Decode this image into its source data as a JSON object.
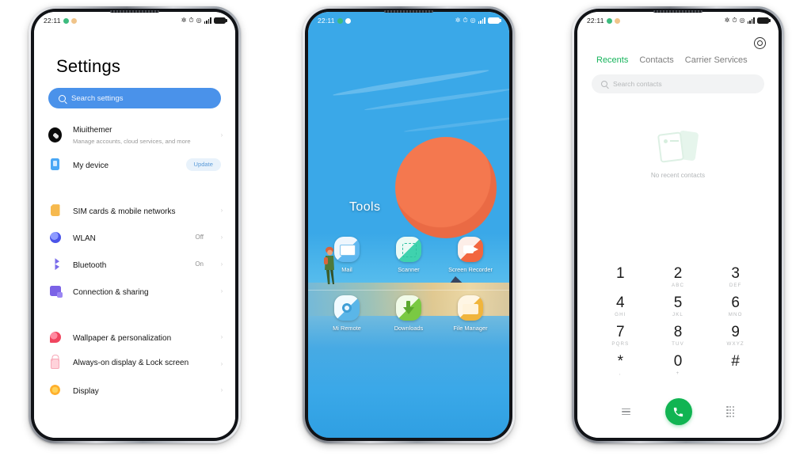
{
  "statusbar": {
    "time": "22:11",
    "icons": [
      "bluetooth-icon",
      "alarm-icon",
      "dnd-icon",
      "signal-icon",
      "battery-icon"
    ]
  },
  "phone1": {
    "app": "Settings",
    "title": "Settings",
    "search": {
      "placeholder": "Search settings",
      "icon": "search-icon"
    },
    "account": {
      "name": "Miuithemer",
      "subtitle": "Manage accounts, cloud services, and more",
      "avatar": "user-avatar"
    },
    "items": [
      {
        "label": "My device",
        "value": "",
        "badge": "Update",
        "icon": "device-icon"
      },
      {
        "label": "SIM cards & mobile networks",
        "value": "",
        "badge": "",
        "icon": "sim-icon"
      },
      {
        "label": "WLAN",
        "value": "Off",
        "badge": "",
        "icon": "wifi-icon"
      },
      {
        "label": "Bluetooth",
        "value": "On",
        "badge": "",
        "icon": "bluetooth-icon"
      },
      {
        "label": "Connection & sharing",
        "value": "",
        "badge": "",
        "icon": "connection-icon"
      },
      {
        "label": "Wallpaper & personalization",
        "value": "",
        "badge": "",
        "icon": "wallpaper-icon"
      },
      {
        "label": "Always-on display & Lock screen",
        "value": "",
        "badge": "",
        "icon": "lock-icon"
      },
      {
        "label": "Display",
        "value": "",
        "badge": "",
        "icon": "display-icon"
      }
    ]
  },
  "phone2": {
    "app": "Home screen folder",
    "folder_title": "Tools",
    "apps_row1": [
      {
        "label": "Mail",
        "icon": "mail-app-icon"
      },
      {
        "label": "Scanner",
        "icon": "scanner-app-icon"
      },
      {
        "label": "Screen Recorder",
        "icon": "screen-recorder-app-icon"
      }
    ],
    "apps_row2": [
      {
        "label": "Mi Remote",
        "icon": "mi-remote-app-icon"
      },
      {
        "label": "Downloads",
        "icon": "downloads-app-icon"
      },
      {
        "label": "File Manager",
        "icon": "file-manager-app-icon"
      }
    ]
  },
  "phone3": {
    "app": "Phone",
    "settings_icon": "gear-icon",
    "tabs": [
      {
        "label": "Recents",
        "active": true
      },
      {
        "label": "Contacts",
        "active": false
      },
      {
        "label": "Carrier Services",
        "active": false
      }
    ],
    "search": {
      "placeholder": "Search contacts",
      "icon": "search-icon"
    },
    "empty_state": {
      "text": "No recent contacts",
      "illustration": "empty-contacts-illustration"
    },
    "keypad": [
      {
        "num": "1",
        "sub": ""
      },
      {
        "num": "2",
        "sub": "ABC"
      },
      {
        "num": "3",
        "sub": "DEF"
      },
      {
        "num": "4",
        "sub": "GHI"
      },
      {
        "num": "5",
        "sub": "JKL"
      },
      {
        "num": "6",
        "sub": "MNO"
      },
      {
        "num": "7",
        "sub": "PQRS"
      },
      {
        "num": "8",
        "sub": "TUV"
      },
      {
        "num": "9",
        "sub": "WXYZ"
      },
      {
        "num": "*",
        "sub": ","
      },
      {
        "num": "0",
        "sub": "+"
      },
      {
        "num": "#",
        "sub": ""
      }
    ],
    "bottom_bar": {
      "menu_icon": "menu-icon",
      "call_icon": "call-icon",
      "dialpad_icon": "dialpad-icon"
    }
  },
  "colors": {
    "accent_blue": "#4a92ea",
    "accent_green": "#17b45c",
    "call_green": "#11b452",
    "wallpaper_sky": "#3aa8e8",
    "wallpaper_sun": "#ea6a44",
    "wallpaper_mountain": "#33405c"
  }
}
